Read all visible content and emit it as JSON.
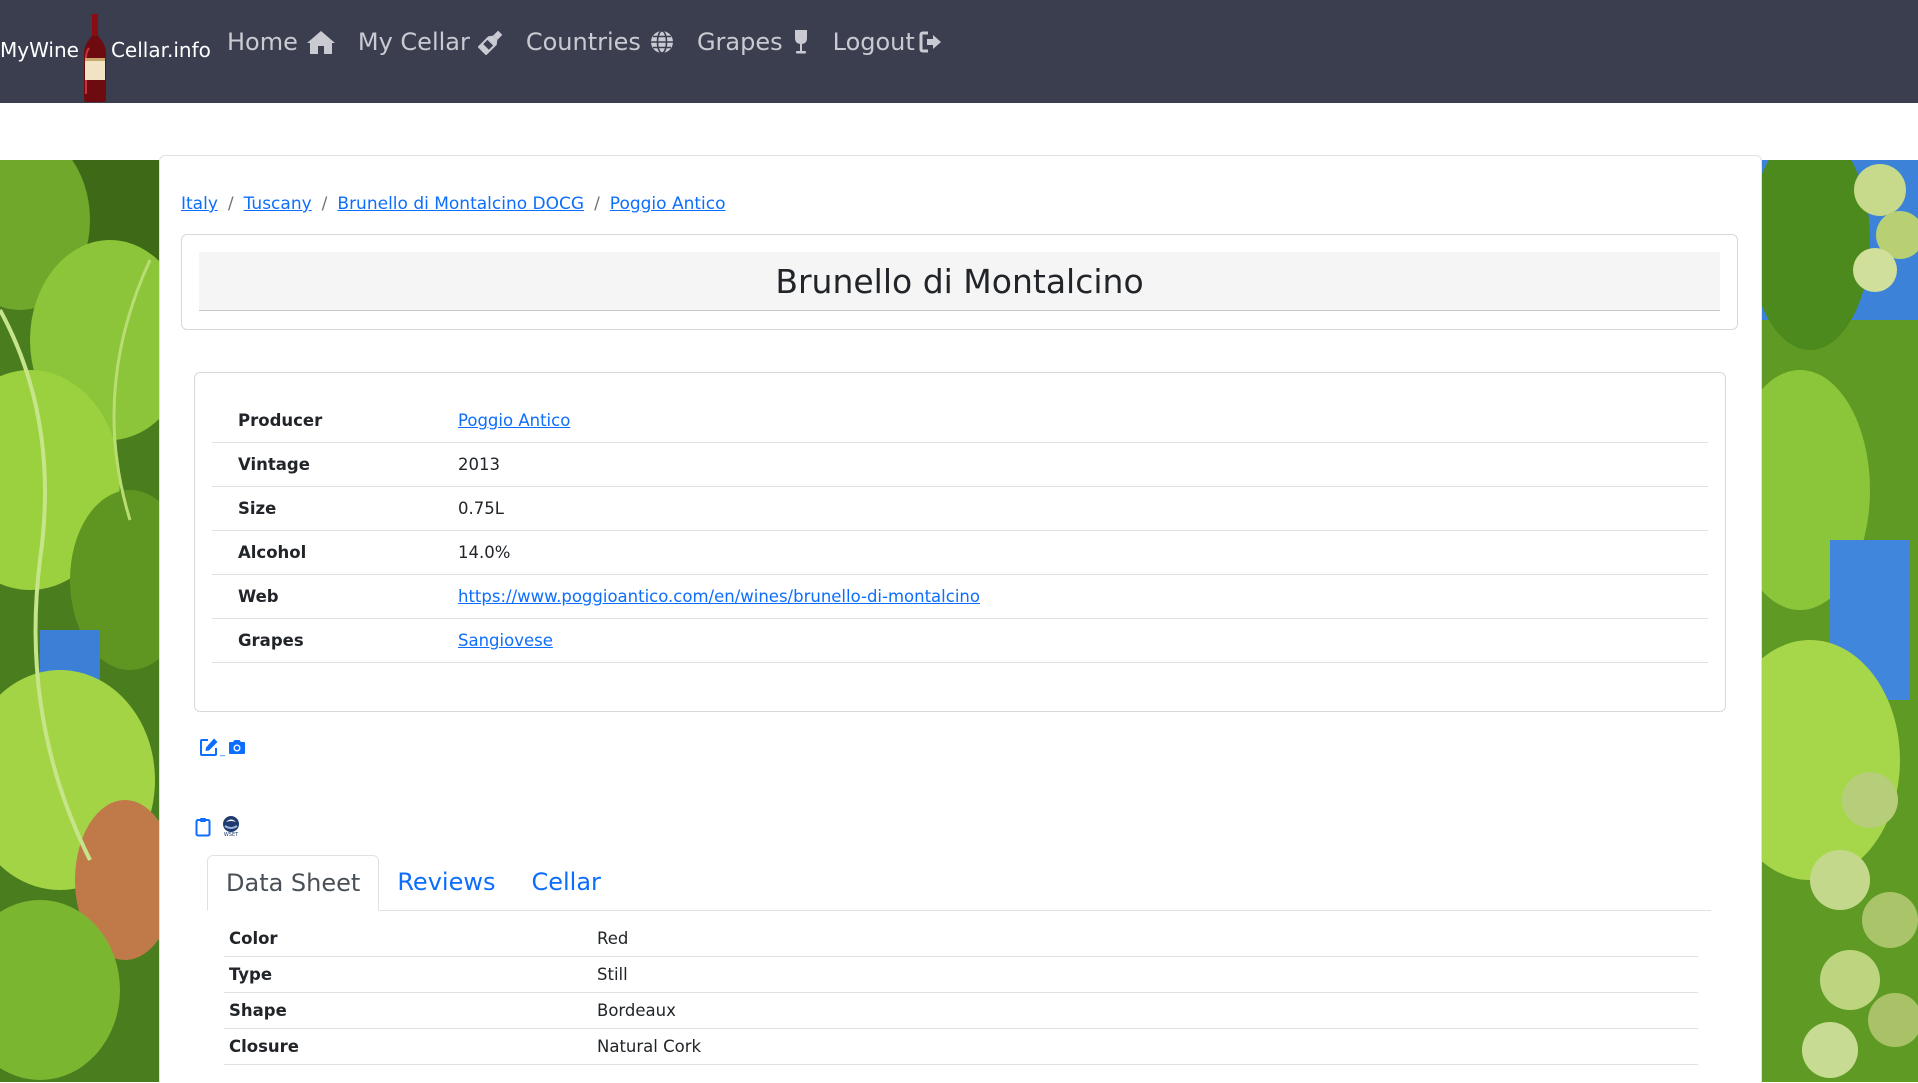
{
  "nav": {
    "brand_left": "MyWine",
    "brand_right": "Cellar.info",
    "links": [
      {
        "label": "Home",
        "icon": "home-icon"
      },
      {
        "label": "My Cellar",
        "icon": "bottle-icon"
      },
      {
        "label": "Countries",
        "icon": "globe-icon"
      },
      {
        "label": "Grapes",
        "icon": "wine-glass-icon"
      },
      {
        "label": "Logout",
        "icon": "sign-out-icon"
      }
    ]
  },
  "breadcrumb": [
    "Italy",
    "Tuscany",
    "Brunello di Montalcino DOCG",
    "Poggio Antico"
  ],
  "wine": {
    "title": "Brunello di Montalcino"
  },
  "info": [
    {
      "label": "Producer",
      "value": "Poggio Antico",
      "link": true
    },
    {
      "label": "Vintage",
      "value": "2013",
      "link": false
    },
    {
      "label": "Size",
      "value": "0.75L",
      "link": false
    },
    {
      "label": "Alcohol",
      "value": "14.0%",
      "link": false
    },
    {
      "label": "Web",
      "value": "https://www.poggioantico.com/en/wines/brunello-di-montalcino",
      "link": true
    },
    {
      "label": "Grapes",
      "value": "Sangiovese",
      "link": true
    }
  ],
  "actions": {
    "edit_icon": "edit-icon",
    "camera_icon": "camera-icon",
    "clipboard_icon": "clipboard-icon",
    "wset_icon": "wset-logo-icon",
    "wset_text": "WSET"
  },
  "tabs": [
    {
      "label": "Data Sheet",
      "active": true
    },
    {
      "label": "Reviews",
      "active": false
    },
    {
      "label": "Cellar",
      "active": false
    }
  ],
  "datasheet": [
    {
      "label": "Color",
      "value": "Red"
    },
    {
      "label": "Type",
      "value": "Still"
    },
    {
      "label": "Shape",
      "value": "Bordeaux"
    },
    {
      "label": "Closure",
      "value": "Natural Cork"
    }
  ],
  "colors": {
    "navbar": "#3a3e4f",
    "link": "#0d6efd",
    "nav_text": "#c9cad2"
  }
}
